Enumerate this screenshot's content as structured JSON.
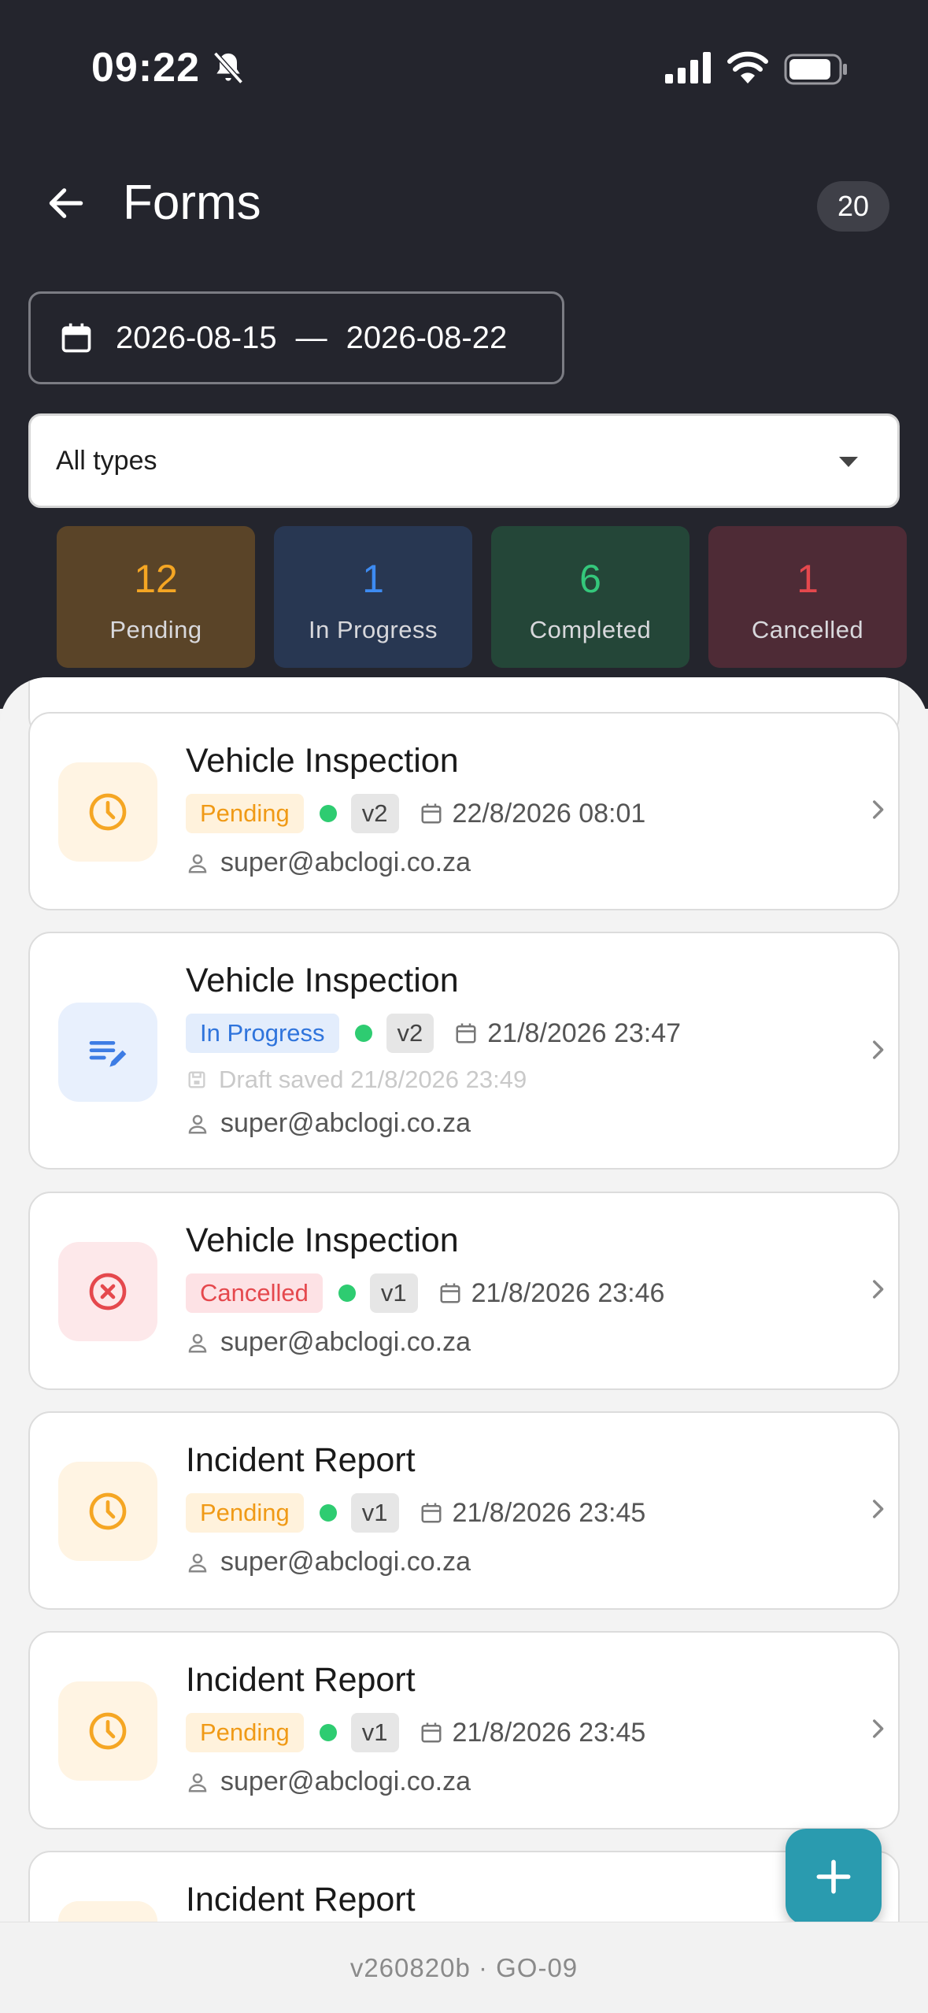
{
  "status_bar": {
    "time": "09:22"
  },
  "header": {
    "title": "Forms",
    "count": "20",
    "date_from": "2026-08-15",
    "date_sep": "—",
    "date_to": "2026-08-22",
    "type_filter": "All types"
  },
  "stats": [
    {
      "value": "12",
      "label": "Pending",
      "color": "#f5a623",
      "bg": "#5a4428"
    },
    {
      "value": "1",
      "label": "In Progress",
      "color": "#3d8bf2",
      "bg": "#283752"
    },
    {
      "value": "6",
      "label": "Completed",
      "color": "#34c77b",
      "bg": "#244638"
    },
    {
      "value": "1",
      "label": "Cancelled",
      "color": "#e5484d",
      "bg": "#4e2b36"
    }
  ],
  "forms": [
    {
      "title": "Vehicle Inspection",
      "status": "Pending",
      "version": "v2",
      "date": "22/8/2026 08:01",
      "user": "super@abclogi.co.za"
    },
    {
      "title": "Vehicle Inspection",
      "status": "In Progress",
      "version": "v2",
      "date": "21/8/2026 23:47",
      "draft": "Draft saved 21/8/2026 23:49",
      "user": "super@abclogi.co.za"
    },
    {
      "title": "Vehicle Inspection",
      "status": "Cancelled",
      "version": "v1",
      "date": "21/8/2026 23:46",
      "user": "super@abclogi.co.za"
    },
    {
      "title": "Incident Report",
      "status": "Pending",
      "version": "v1",
      "date": "21/8/2026 23:45",
      "user": "super@abclogi.co.za"
    },
    {
      "title": "Incident Report",
      "status": "Pending",
      "version": "v1",
      "date": "21/8/2026 23:45",
      "user": "super@abclogi.co.za"
    },
    {
      "title": "Incident Report"
    }
  ],
  "footer": {
    "version": "v260820b · GO-09"
  }
}
